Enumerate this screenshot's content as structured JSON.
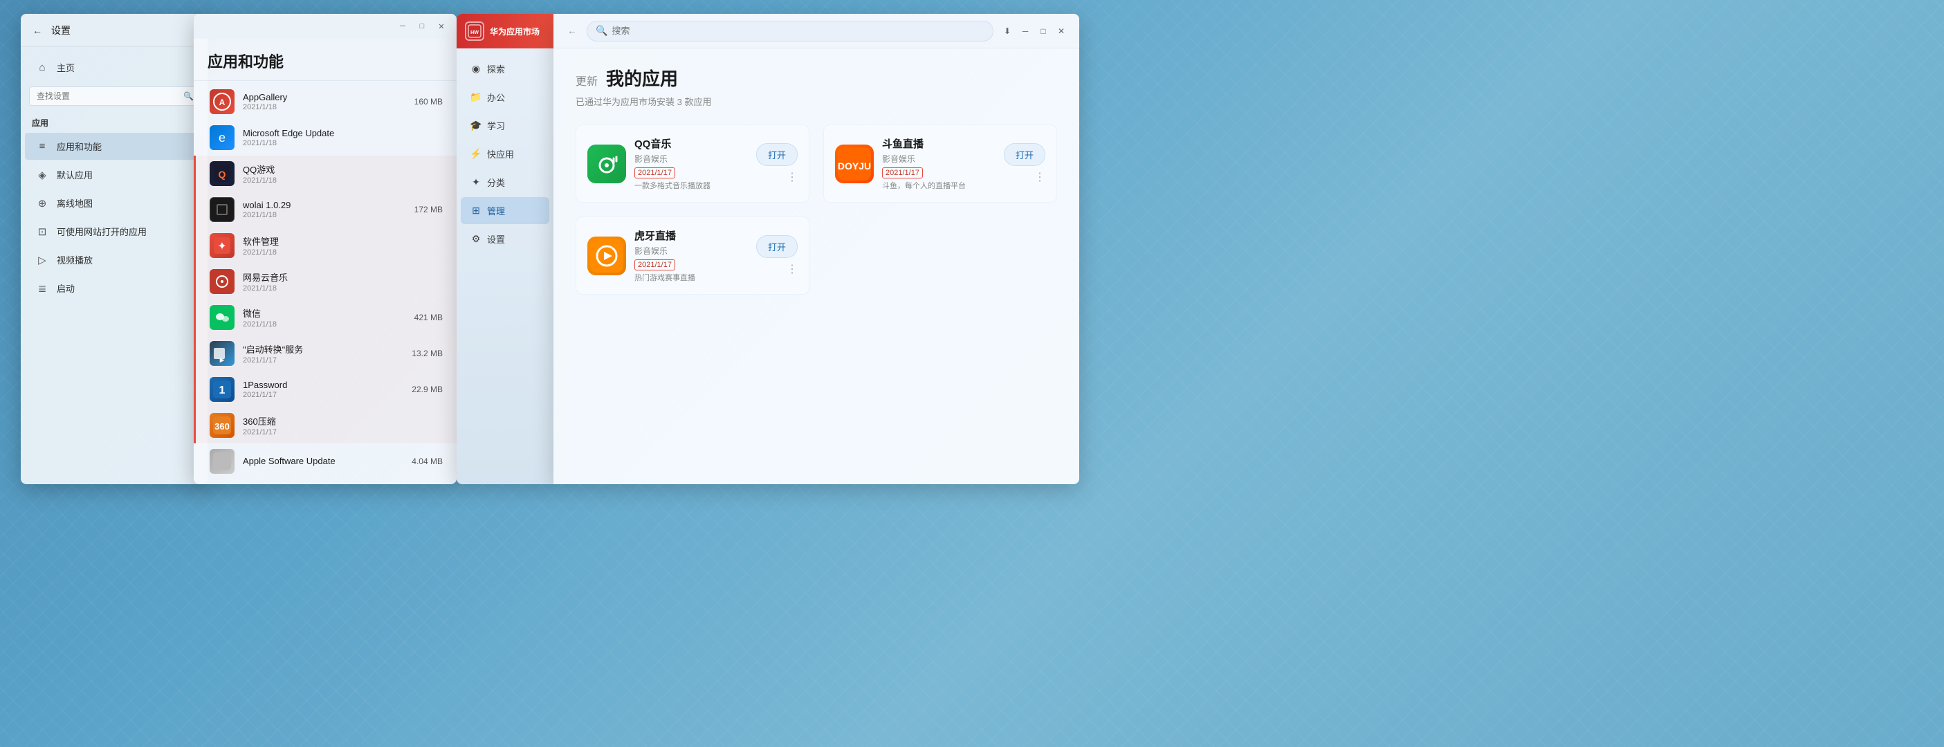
{
  "settings": {
    "title": "设置",
    "back_label": "←",
    "search_placeholder": "查找设置",
    "home_label": "主页",
    "section_apps": "应用",
    "nav": [
      {
        "id": "home",
        "label": "主页",
        "icon": "⌂"
      },
      {
        "id": "apps-features",
        "label": "应用和功能",
        "icon": "≡",
        "active": true
      },
      {
        "id": "default-apps",
        "label": "默认应用",
        "icon": "◈"
      },
      {
        "id": "offline-maps",
        "label": "离线地图",
        "icon": "⊕"
      },
      {
        "id": "website-apps",
        "label": "可使用网站打开的应用",
        "icon": "⊡"
      },
      {
        "id": "video-playback",
        "label": "视频播放",
        "icon": "▷"
      },
      {
        "id": "startup",
        "label": "启动",
        "icon": "≣"
      }
    ]
  },
  "apps_window": {
    "title": "应用和功能",
    "min_label": "─",
    "max_label": "□",
    "close_label": "✕",
    "apps": [
      {
        "id": "appgallery",
        "name": "AppGallery",
        "size": "160 MB",
        "date": "2021/1/18",
        "highlighted": false,
        "icon_type": "appgallery"
      },
      {
        "id": "edge-update",
        "name": "Microsoft Edge Update",
        "size": "",
        "date": "2021/1/18",
        "highlighted": false,
        "icon_type": "edge"
      },
      {
        "id": "qq-game",
        "name": "QQ游戏",
        "size": "",
        "date": "2021/1/18",
        "highlighted": true,
        "icon_type": "qq-game"
      },
      {
        "id": "wolai",
        "name": "wolai 1.0.29",
        "size": "172 MB",
        "date": "2021/1/18",
        "highlighted": true,
        "icon_type": "wolai"
      },
      {
        "id": "software-mgr",
        "name": "软件管理",
        "size": "",
        "date": "2021/1/18",
        "highlighted": true,
        "icon_type": "software"
      },
      {
        "id": "netease-music",
        "name": "网易云音乐",
        "size": "",
        "date": "2021/1/18",
        "highlighted": true,
        "icon_type": "netease"
      },
      {
        "id": "wechat",
        "name": "微信",
        "size": "421 MB",
        "date": "2021/1/18",
        "highlighted": true,
        "icon_type": "wechat"
      },
      {
        "id": "autorun",
        "name": "\"启动转换\"服务",
        "size": "13.2 MB",
        "date": "2021/1/17",
        "highlighted": true,
        "icon_type": "autorun"
      },
      {
        "id": "1password",
        "name": "1Password",
        "size": "22.9 MB",
        "date": "2021/1/17",
        "highlighted": true,
        "icon_type": "1password"
      },
      {
        "id": "360zip",
        "name": "360压缩",
        "size": "",
        "date": "2021/1/17",
        "highlighted": true,
        "icon_type": "360"
      },
      {
        "id": "apple-update",
        "name": "Apple Software Update",
        "size": "4.04 MB",
        "date": "",
        "highlighted": false,
        "icon_type": "apple"
      }
    ]
  },
  "huawei_sidebar": {
    "logo_text": "HUAWEI",
    "title": "华为应用市场",
    "nav": [
      {
        "id": "explore",
        "label": "探索",
        "icon": "◉"
      },
      {
        "id": "office",
        "label": "办公",
        "icon": "📁"
      },
      {
        "id": "study",
        "label": "学习",
        "icon": "🎓"
      },
      {
        "id": "quick-apps",
        "label": "快应用",
        "icon": "⚡"
      },
      {
        "id": "category",
        "label": "分类",
        "icon": "✦"
      },
      {
        "id": "manage",
        "label": "管理",
        "icon": "⊞",
        "active": true
      },
      {
        "id": "settings",
        "label": "设置",
        "icon": "⚙"
      }
    ]
  },
  "huawei_main": {
    "search_placeholder": "搜索",
    "back_label": "←",
    "download_icon": "⬇",
    "min_label": "─",
    "max_label": "□",
    "close_label": "✕",
    "content": {
      "update_label": "更新",
      "my_apps_label": "我的应用",
      "installed_count": "已通过华为应用市场安装 3 款应用",
      "apps": [
        {
          "id": "qq-music",
          "name": "QQ音乐",
          "category": "影音娱乐",
          "date": "2021/1/17",
          "desc": "一款多格式音乐播放器",
          "open_label": "打开",
          "icon_type": "qq-music"
        },
        {
          "id": "douyu",
          "name": "斗鱼直播",
          "category": "影音娱乐",
          "date": "2021/1/17",
          "desc": "斗鱼，每个人的直播平台",
          "open_label": "打开",
          "icon_type": "douyu"
        },
        {
          "id": "huya",
          "name": "虎牙直播",
          "category": "影音娱乐",
          "date": "2021/1/17",
          "desc": "热门游戏赛事直播",
          "open_label": "打开",
          "icon_type": "huya"
        }
      ]
    }
  }
}
